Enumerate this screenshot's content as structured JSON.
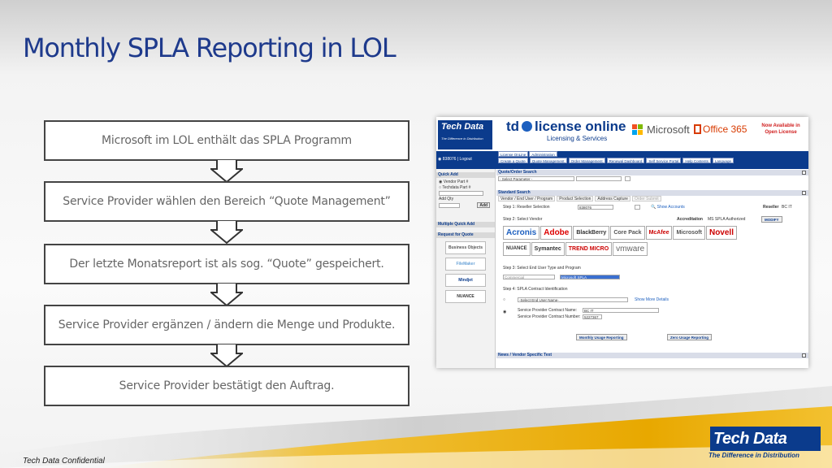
{
  "slide": {
    "title": "Monthly SPLA Reporting in LOL",
    "footer": "Tech Data Confidential"
  },
  "flow_steps": [
    "Microsoft im LOL enthält das SPLA Programm",
    "Service Provider wählen den Bereich “Quote Management”",
    "Der letzte Monatsreport ist als sog. “Quote” gespeichert.",
    "Service Provider ergänzen / ändern die Menge und Produkte.",
    "Service Provider bestätigt den Auftrag."
  ],
  "brand": {
    "name": "Tech Data",
    "tagline": "The Difference in Distribution",
    "primary_color": "#0b3b8c",
    "accent_color": "#f0b400"
  },
  "screenshot": {
    "header": {
      "td_brand": "Tech Data",
      "td_tagline": "The Difference in Distribution",
      "logo_td": "td",
      "logo_lo": "license online",
      "logo_sub": "Licensing & Services",
      "ms": "Microsoft",
      "office": "Office 365",
      "now_available": "Now Available in Open License"
    },
    "user_id": "838076",
    "logout": "Logout",
    "nav_tabs_top": [
      "License OnLine",
      "Administration"
    ],
    "nav_tabs": [
      "Create a Quote",
      "Quote Management",
      "Order Management",
      "Renewal Dashboard",
      "Self Service Portal",
      "Help Contents",
      "Language"
    ],
    "sidebar": {
      "quick_add": "Quick Add",
      "vendor_part": "Vendor Part #",
      "techdata_part": "Techdata Part #",
      "add_qty": "Add Qty",
      "add_btn": "Add",
      "multiple_quick_add": "Multiple Quick Add",
      "request_for_quote": "Request for Quote",
      "vendors": [
        "Business Objects",
        "FileMaker",
        "Mindjet",
        "NUANCE"
      ]
    },
    "main": {
      "quote_search": "Quote/Order Search",
      "select_param": "- Select Parameter -",
      "standard_search": "Standard Search",
      "subtabs": [
        "Vendor / End User / Program",
        "Product Selection",
        "Address Capture",
        "Order Submit"
      ],
      "step1": "Step 1: Reseller Selection",
      "step1_value": "838076",
      "show_accounts": "Show Accounts",
      "reseller_label": "Reseller",
      "reseller_value": "BC IT",
      "step2": "Step 2: Select Vendor",
      "accreditation_label": "Accreditation",
      "accreditation_value": "MS SPLA Authorized",
      "modify": "MODIFY",
      "vendors_row1": [
        "Acronis",
        "Adobe",
        "BlackBerry",
        "Core Pack",
        "McAfee",
        "Microsoft",
        "Novell"
      ],
      "vendors_row2": [
        "NUANCE",
        "Symantec",
        "TREND MICRO",
        "vmware"
      ],
      "step3": "Step 3: Select End User Type and Program",
      "enduser_type": "Commercial",
      "program": "Microsoft SPLA",
      "step4": "Step 4: SPLA Contract Identification",
      "select_enduser": "-Select End User Name-",
      "show_more": "Show More Details",
      "sp_contract_name_label": "Service Provider Contract Name:",
      "sp_contract_name": "BC IT",
      "sp_contract_number_label": "Service Provider Contract Number:",
      "sp_contract_number": "5227367",
      "monthly_btn": "Monthly Usage Reporting",
      "zero_btn": "Zero Usage Reporting",
      "news": "News / Vendor Specific Text"
    }
  }
}
